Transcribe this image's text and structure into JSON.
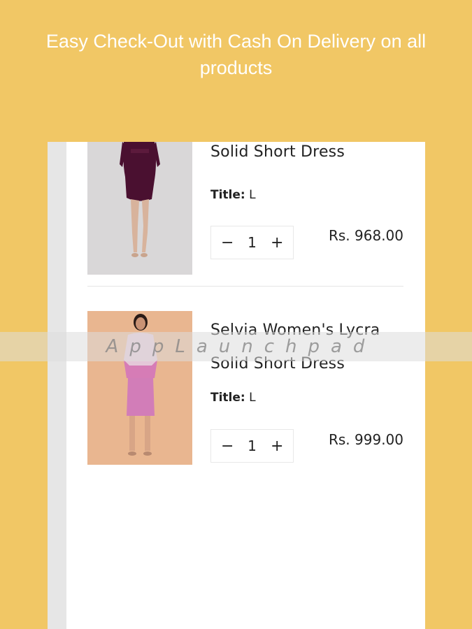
{
  "headline": "Easy Check-Out with Cash On Delivery on all products",
  "cart": {
    "items": [
      {
        "name": "Solid Short Dress",
        "variant_key": "Title:",
        "variant_value": "L",
        "quantity": "1",
        "price": "Rs. 968.00",
        "image_icon": "maroon-dress-photo",
        "minus": "−",
        "plus": "+"
      },
      {
        "name": "Selvia Women's Lycra Solid Short Dress",
        "variant_key": "Title:",
        "variant_value": "L",
        "quantity": "1",
        "price": "Rs. 999.00",
        "image_icon": "pink-dress-photo",
        "minus": "−",
        "plus": "+"
      }
    ]
  },
  "watermark": "AppLaunchpad",
  "colors": {
    "background": "#f1c765",
    "card": "#ffffff",
    "text": "#222222"
  }
}
